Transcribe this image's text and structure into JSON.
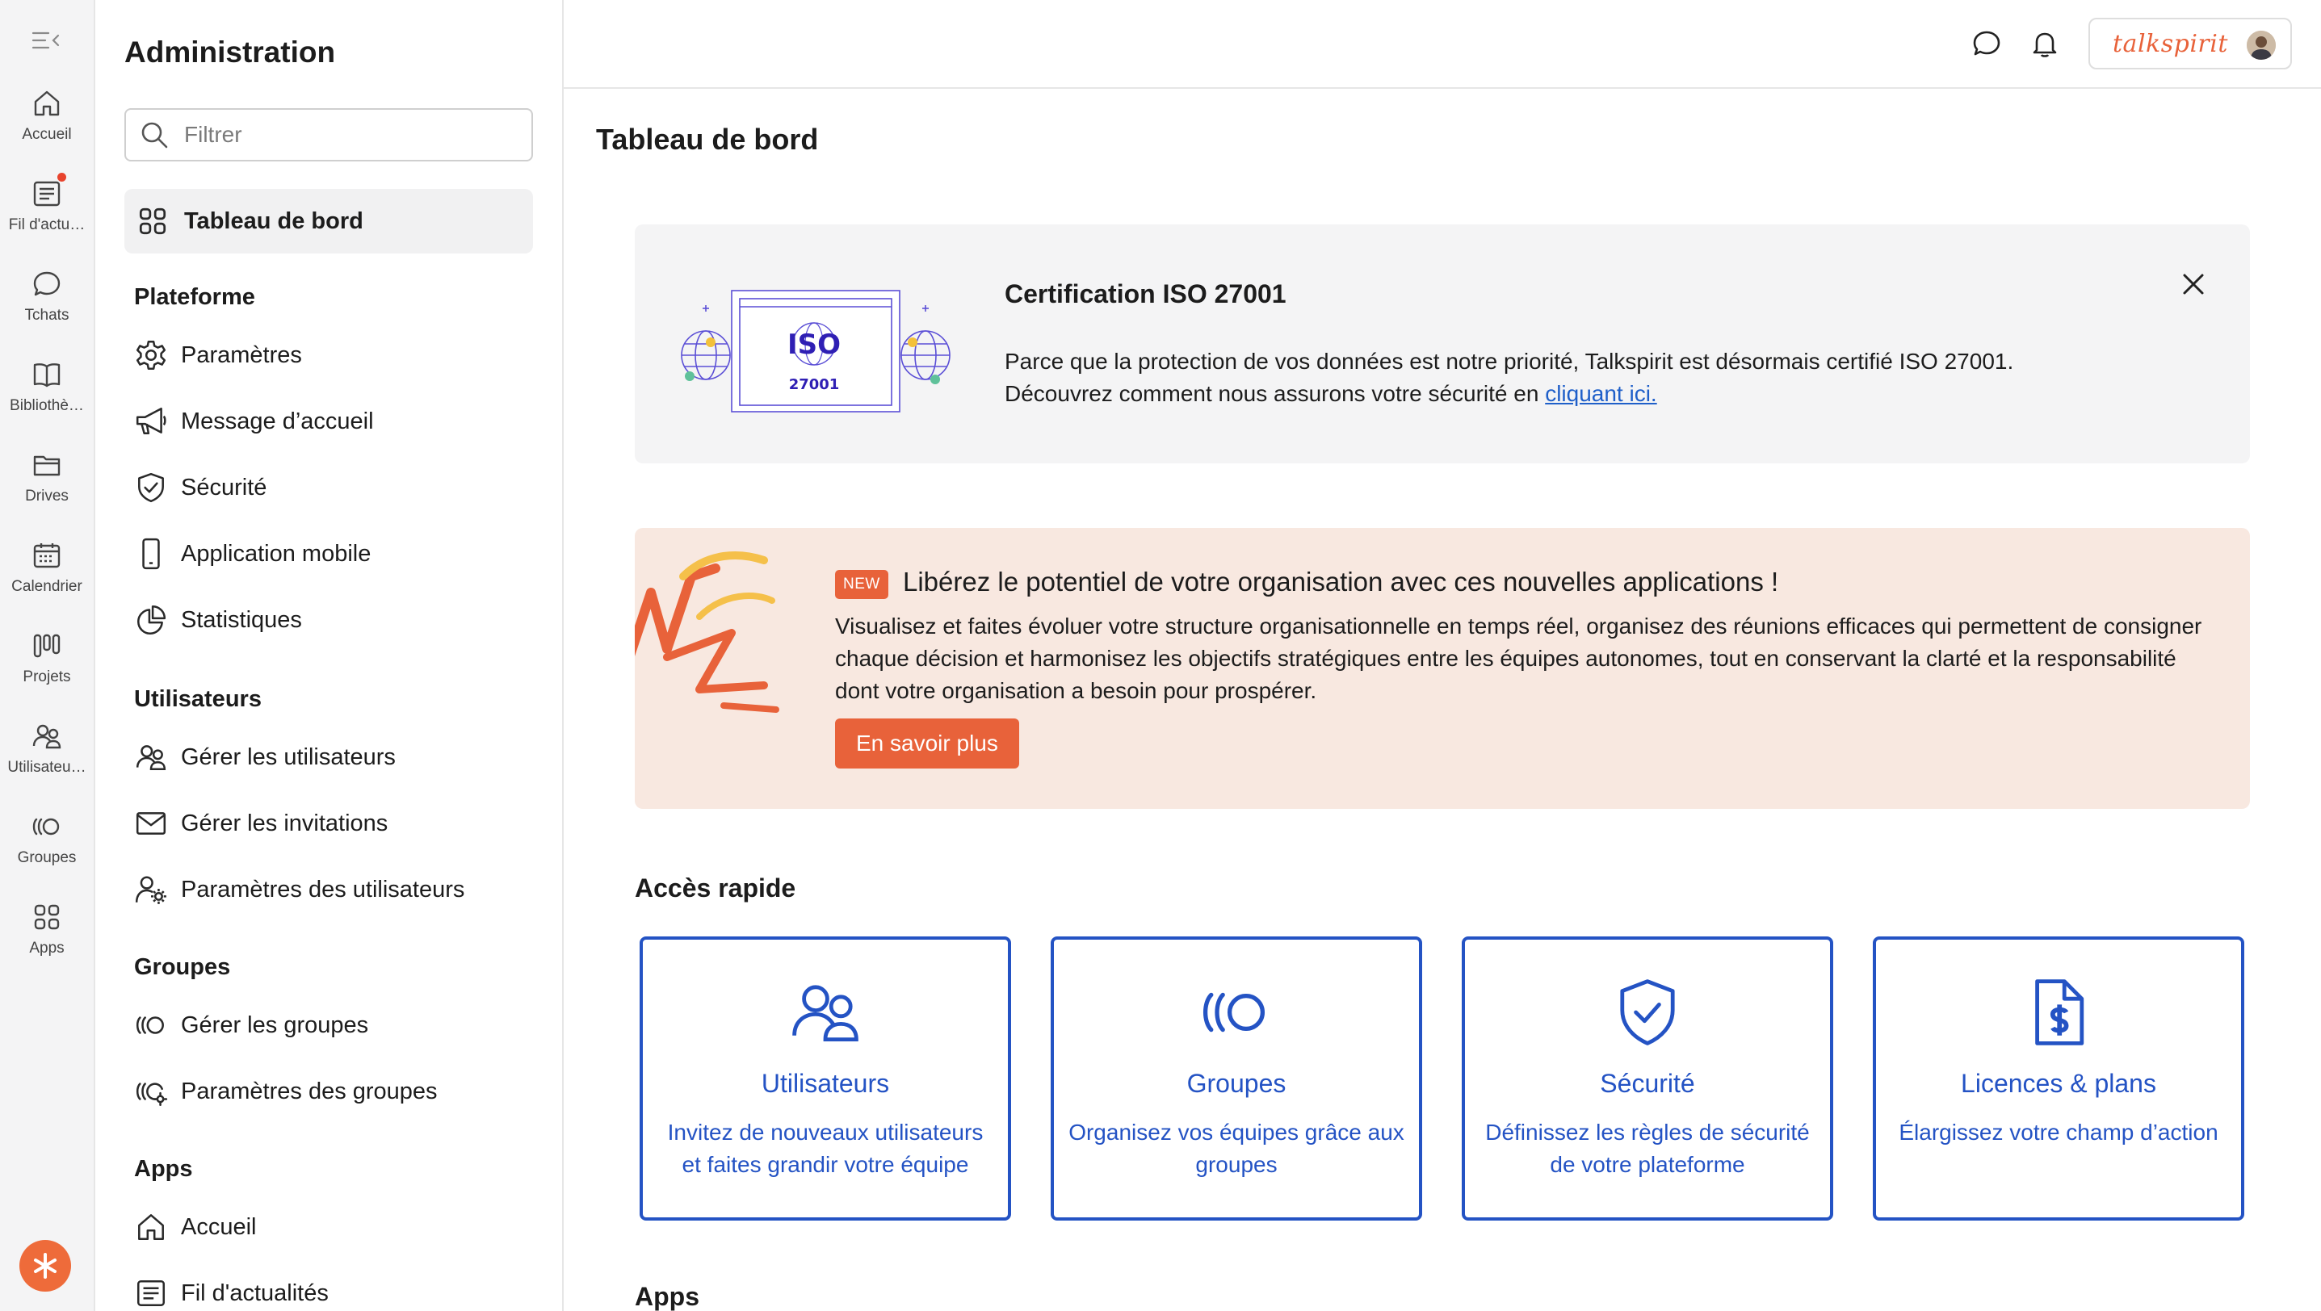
{
  "rail": {
    "items": [
      {
        "label": "Accueil",
        "icon": "home-icon"
      },
      {
        "label": "Fil d'actu…",
        "icon": "news-feed-icon",
        "notification": true
      },
      {
        "label": "Tchats",
        "icon": "chat-icon"
      },
      {
        "label": "Bibliothè…",
        "icon": "book-icon"
      },
      {
        "label": "Drives",
        "icon": "folder-icon"
      },
      {
        "label": "Calendrier",
        "icon": "calendar-icon"
      },
      {
        "label": "Projets",
        "icon": "projects-icon"
      },
      {
        "label": "Utilisateu…",
        "icon": "users-icon"
      },
      {
        "label": "Groupes",
        "icon": "groups-icon"
      },
      {
        "label": "Apps",
        "icon": "apps-icon"
      }
    ]
  },
  "sidebar": {
    "title": "Administration",
    "filter_placeholder": "Filtrer",
    "active_item": "Tableau de bord",
    "sections": [
      {
        "heading": "Plateforme",
        "items": [
          "Paramètres",
          "Message d’accueil",
          "Sécurité",
          "Application mobile",
          "Statistiques"
        ]
      },
      {
        "heading": "Utilisateurs",
        "items": [
          "Gérer les utilisateurs",
          "Gérer les invitations",
          "Paramètres des utilisateurs"
        ]
      },
      {
        "heading": "Groupes",
        "items": [
          "Gérer les groupes",
          "Paramètres des groupes"
        ]
      },
      {
        "heading": "Apps",
        "items": [
          "Accueil",
          "Fil d'actualités"
        ]
      }
    ]
  },
  "topbar": {
    "brand": "talkspirit"
  },
  "main": {
    "title": "Tableau de bord",
    "iso": {
      "art_title": "ISO",
      "art_number": "27001",
      "title": "Certification ISO 27001",
      "line1": "Parce que la protection de vos données est notre priorité, Talkspirit est désormais certifié ISO 27001.",
      "line2_prefix": "Découvrez comment nous assurons votre sécurité en ",
      "link": "cliquant ici."
    },
    "promo": {
      "badge": "NEW",
      "title": "Libérez le potentiel de votre organisation avec ces nouvelles applications !",
      "text": "Visualisez et faites évoluer votre structure organisationnelle en temps réel, organisez des réunions efficaces qui permettent de consigner chaque décision et harmonisez les objectifs stratégiques entre les équipes autonomes, tout en conservant la clarté et la responsabilité dont votre organisation a besoin pour prospérer.",
      "button": "En savoir plus"
    },
    "quick_access": {
      "title": "Accès rapide",
      "cards": [
        {
          "name": "Utilisateurs",
          "desc": "Invitez de nouveaux utilisateurs et faites grandir votre équipe",
          "icon": "users-icon"
        },
        {
          "name": "Groupes",
          "desc": "Organisez vos équipes grâce aux groupes",
          "icon": "groups-icon"
        },
        {
          "name": "Sécurité",
          "desc": "Définissez les règles de sécurité de votre plateforme",
          "icon": "shield-check-icon"
        },
        {
          "name": "Licences & plans",
          "desc": "Élargissez votre champ d’action",
          "icon": "dollar-document-icon"
        }
      ]
    },
    "apps_title": "Apps"
  },
  "colors": {
    "accent": "#e8623a",
    "link_blue": "#2453c4",
    "notification": "#e8432d"
  }
}
